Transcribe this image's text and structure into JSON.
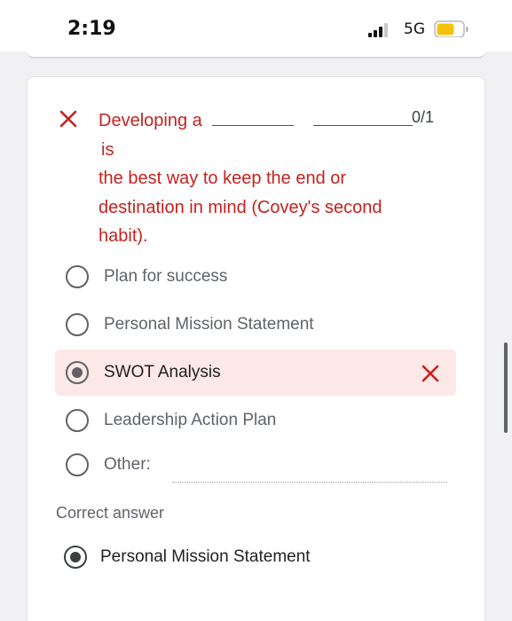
{
  "status_bar": {
    "time": "2:19",
    "network": "5G",
    "battery_color": "#f4c20d"
  },
  "question": {
    "text_part1": "Developing a",
    "text_part2": "is",
    "text_rest": "the best way to keep the end or destination in mind (Covey's second habit).",
    "score": "0/1",
    "status_icon": "wrong-x-icon",
    "error_color": "#c5221f"
  },
  "options": [
    {
      "label": "Plan for success",
      "selected": false
    },
    {
      "label": "Personal Mission Statement",
      "selected": false
    },
    {
      "label": "SWOT Analysis",
      "selected": true,
      "marked_wrong": true
    },
    {
      "label": "Leadership Action Plan",
      "selected": false
    },
    {
      "label": "Other:",
      "selected": false
    }
  ],
  "correct": {
    "title": "Correct answer",
    "answer": "Personal Mission Statement"
  }
}
